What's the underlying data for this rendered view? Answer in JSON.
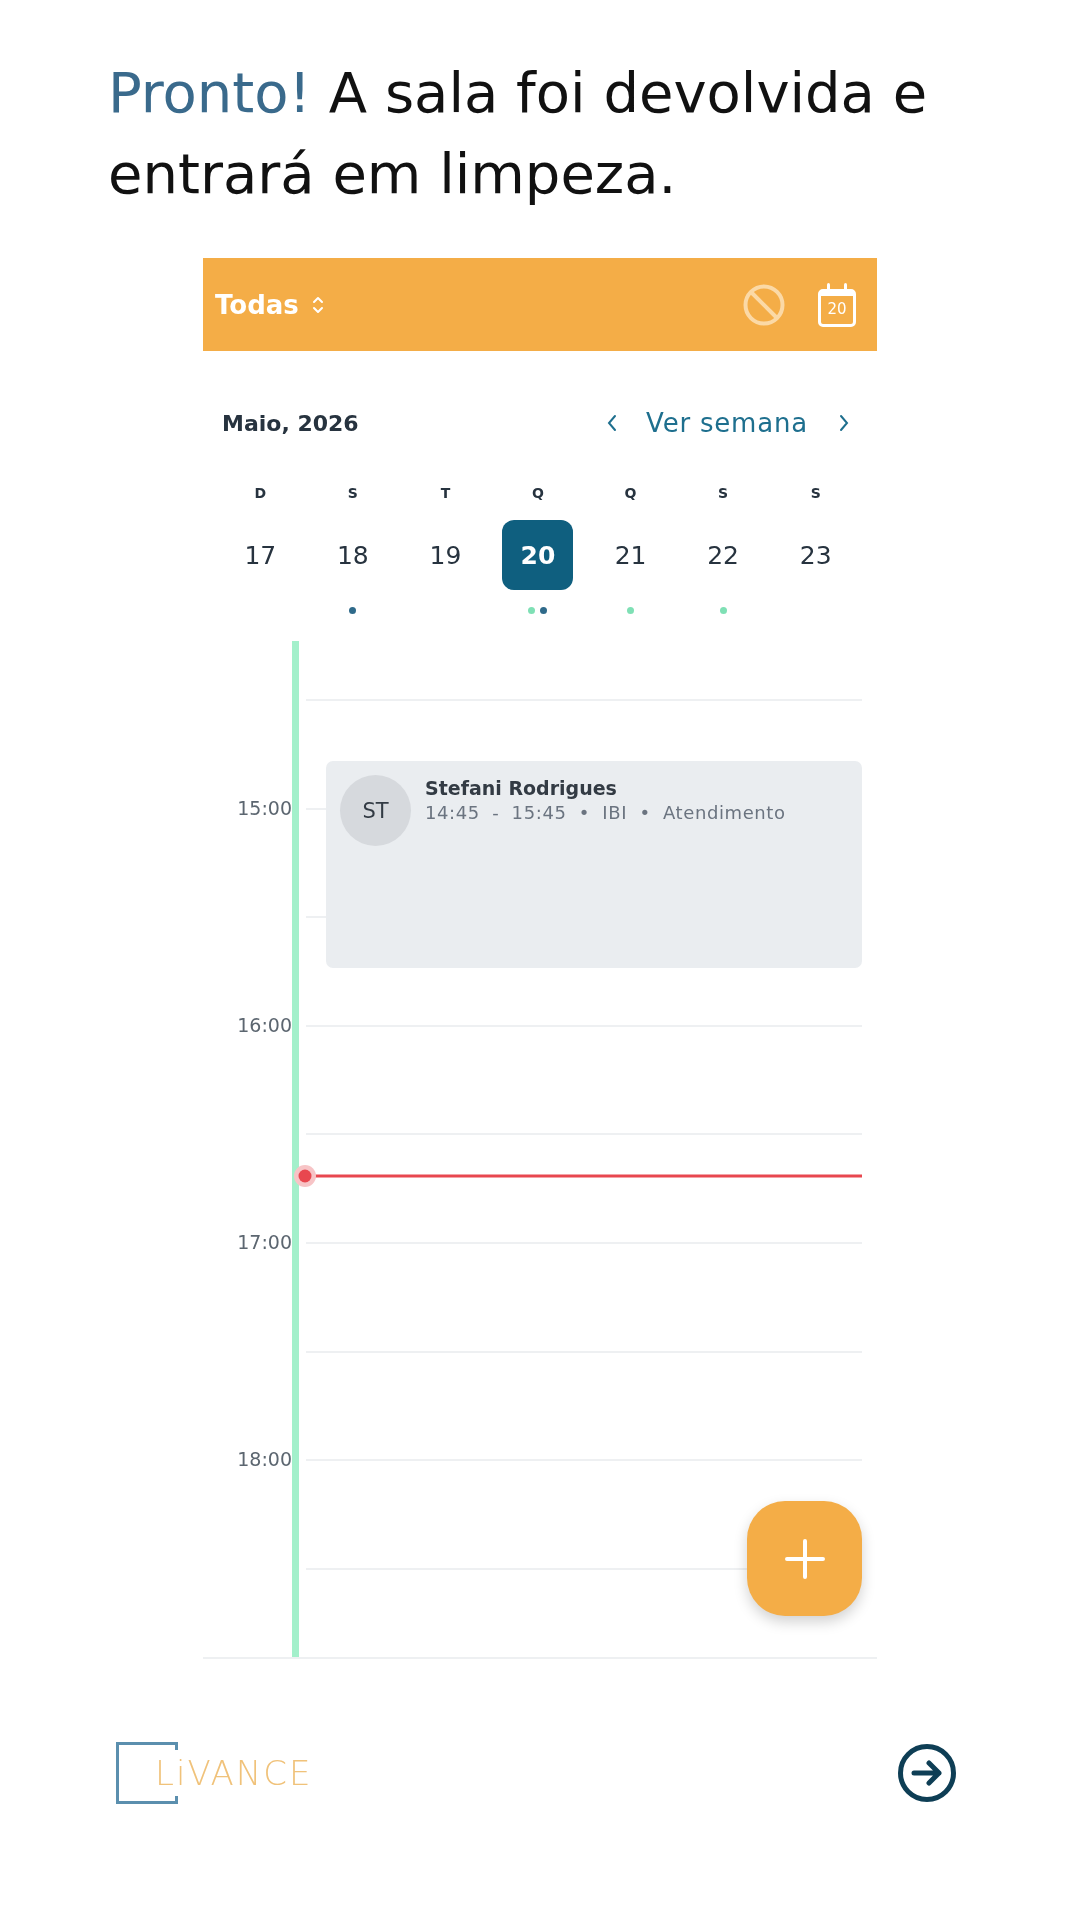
{
  "message": {
    "highlight": "Pronto!",
    "text": "A sala foi devolvida e entrará em limpeza."
  },
  "agenda": {
    "filter": "Todas",
    "today_button": "20",
    "month": "Maio, 2026",
    "week_link": "Ver semana",
    "days": [
      {
        "weekday": "D",
        "date": "17",
        "selected": false
      },
      {
        "weekday": "S",
        "date": "18",
        "selected": false,
        "dots": [
          {
            "color": "#2f6a8a"
          }
        ]
      },
      {
        "weekday": "T",
        "date": "19",
        "selected": false
      },
      {
        "weekday": "Q",
        "date": "20",
        "selected": true,
        "dots": [
          {
            "color": "#7fe0b5"
          },
          {
            "color": "#2f6a8a"
          }
        ]
      },
      {
        "weekday": "Q",
        "date": "21",
        "selected": false,
        "dots": [
          {
            "color": "#7fe0b5"
          }
        ]
      },
      {
        "weekday": "S",
        "date": "22",
        "selected": false,
        "dots": [
          {
            "color": "#7fe0b5"
          }
        ]
      },
      {
        "weekday": "S",
        "date": "23",
        "selected": false
      }
    ],
    "hours": [
      "15:00",
      "16:00",
      "17:00",
      "18:00"
    ],
    "events": [
      {
        "initials": "ST",
        "name": "Stefani Rodrigues",
        "details": "14:45 - 15:45 • IBI • Atendimento"
      }
    ]
  },
  "footer": {
    "brand": "LiVANCE"
  }
}
